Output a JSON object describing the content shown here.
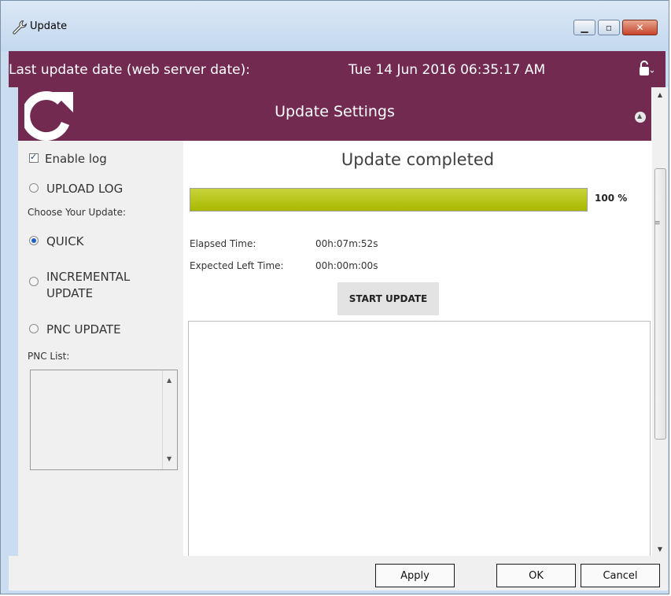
{
  "window": {
    "title": "Update",
    "icon": "wrench-icon",
    "controls": {
      "minimize_icon": "minimize-icon",
      "maximize_icon": "maximize-icon",
      "close_icon": "close-icon"
    }
  },
  "header": {
    "last_update_label": "Last update date (web server date):",
    "last_update_value": "Tue 14 Jun 2016 06:35:17 AM",
    "lock_icon": "padlock-icon"
  },
  "settings": {
    "title": "Update Settings",
    "icon": "refresh-icon",
    "collapse_icon": "chevron-up-icon"
  },
  "left": {
    "enable_log_label": "Enable log",
    "enable_log_checked": true,
    "upload_log_label": "UPLOAD LOG",
    "choose_update_label": "Choose Your Update:",
    "options": [
      {
        "label": "QUICK",
        "selected": true
      },
      {
        "label": "INCREMENTAL UPDATE",
        "selected": false
      },
      {
        "label": "PNC UPDATE",
        "selected": false
      }
    ],
    "pnc_list_label": "PNC List:"
  },
  "main": {
    "status": "Update completed",
    "progress_percent": 100,
    "progress_label": "100 %",
    "elapsed_label": "Elapsed Time:",
    "elapsed_value": "00h:07m:52s",
    "expected_label": "Expected Left Time:",
    "expected_value": "00h:00m:00s",
    "start_button": "START UPDATE"
  },
  "footer": {
    "apply": "Apply",
    "ok": "OK",
    "cancel": "Cancel"
  },
  "colors": {
    "accent": "#722a51",
    "progress": "#b3c000",
    "window_frame": "#c9dcf0"
  }
}
